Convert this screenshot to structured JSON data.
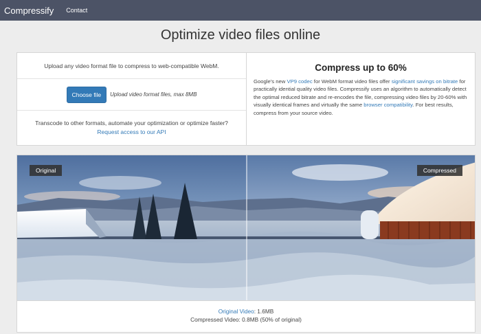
{
  "nav": {
    "brand": "Compressify",
    "contact": "Contact"
  },
  "page_title": "Optimize video files online",
  "upload": {
    "intro": "Upload any video format file to compress to web-compatible WebM.",
    "choose_file": "Choose file",
    "hint": "Upload video format files, max 8MB",
    "api_text": "Transcode to other formats, automate your optimization or optimize faster?",
    "api_link": "Request access to our API"
  },
  "info": {
    "title": "Compress up to 60%",
    "p1": "Google's new ",
    "link1": "VP9 codec",
    "p2": " for WebM format video files offer ",
    "link2": "significant savings on bitrate",
    "p3": " for practically idential quality video files. Compressify uses an algorithm to automatically detect the optimal reduced bitrate and re-encodes the file, compressing video files by 20-60% with visually identical frames and virtually the same ",
    "link3": "browser compatibility",
    "p4": ". For best results, compress from your source video."
  },
  "compare": {
    "label_original": "Original",
    "label_compressed": "Compressed"
  },
  "results": {
    "original_label": "Original Video",
    "original_value": ": 1.6MB",
    "compressed_text": "Compressed Video: 0.8MB (50% of original)"
  }
}
